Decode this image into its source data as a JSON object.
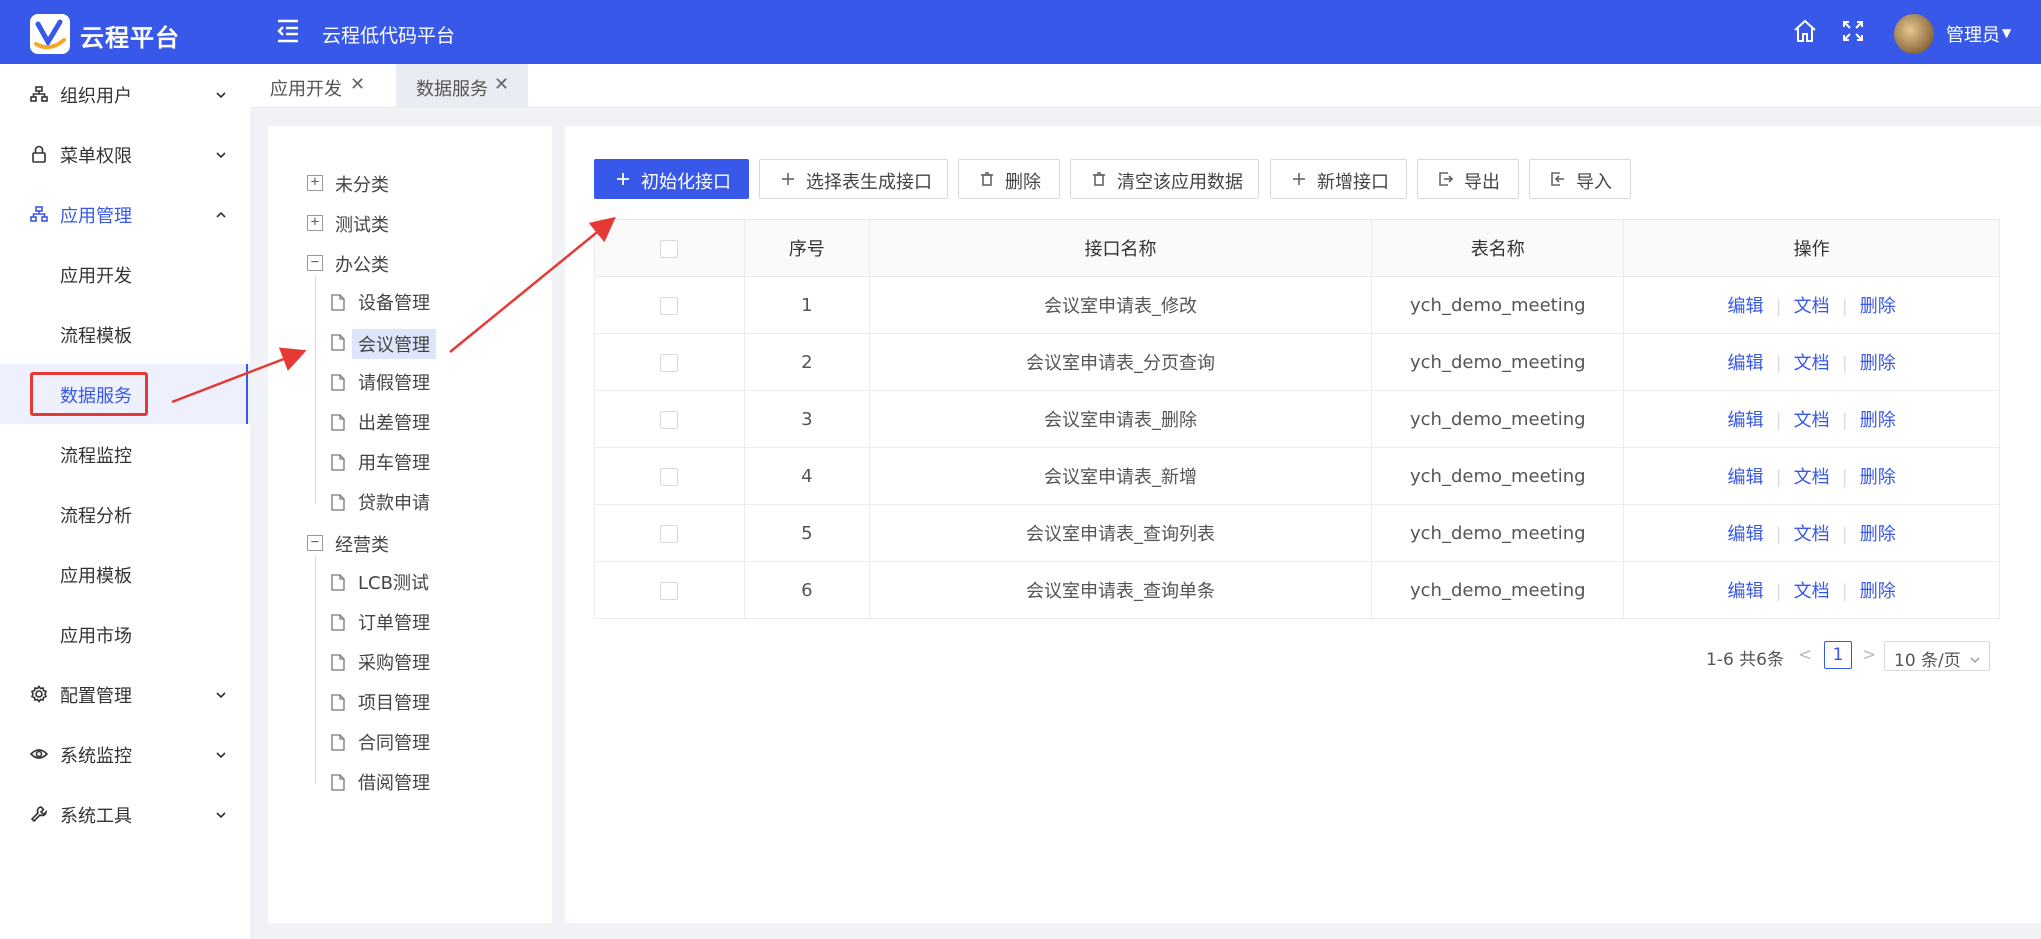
{
  "header": {
    "app_title": "云程平台",
    "platform_title": "云程低代码平台",
    "user_name": "管理员",
    "bg_color": "#3858e9"
  },
  "sidebar": {
    "items": [
      {
        "label": "组织用户",
        "icon": "org-icon",
        "expandable": true
      },
      {
        "label": "菜单权限",
        "icon": "lock-icon",
        "expandable": true
      },
      {
        "label": "应用管理",
        "icon": "app-tree-icon",
        "expandable": true,
        "expanded": true
      },
      {
        "label": "应用开发"
      },
      {
        "label": "流程模板"
      },
      {
        "label": "数据服务",
        "selected": true
      },
      {
        "label": "流程监控"
      },
      {
        "label": "流程分析"
      },
      {
        "label": "应用模板"
      },
      {
        "label": "应用市场"
      },
      {
        "label": "配置管理",
        "icon": "gear-icon",
        "expandable": true
      },
      {
        "label": "系统监控",
        "icon": "eye-icon",
        "expandable": true
      },
      {
        "label": "系统工具",
        "icon": "wrench-icon",
        "expandable": true
      }
    ]
  },
  "tabs": [
    {
      "label": "应用开发",
      "active": false
    },
    {
      "label": "数据服务",
      "active": true
    }
  ],
  "tree": {
    "categories": [
      {
        "label": "未分类",
        "expanded": false,
        "children": []
      },
      {
        "label": "测试类",
        "expanded": false,
        "children": []
      },
      {
        "label": "办公类",
        "expanded": true,
        "children": [
          "设备管理",
          "会议管理",
          "请假管理",
          "出差管理",
          "用车管理",
          "贷款申请"
        ]
      },
      {
        "label": "经营类",
        "expanded": true,
        "children": [
          "LCB测试",
          "订单管理",
          "采购管理",
          "项目管理",
          "合同管理",
          "借阅管理"
        ]
      }
    ],
    "selected": "会议管理"
  },
  "toolbar": {
    "buttons": [
      {
        "label": "初始化接口",
        "icon": "plus-icon",
        "primary": true
      },
      {
        "label": "选择表生成接口",
        "icon": "plus-icon"
      },
      {
        "label": "删除",
        "icon": "trash-icon"
      },
      {
        "label": "清空该应用数据",
        "icon": "trash-icon"
      },
      {
        "label": "新增接口",
        "icon": "plus-icon"
      },
      {
        "label": "导出",
        "icon": "export-icon"
      },
      {
        "label": "导入",
        "icon": "import-icon"
      }
    ]
  },
  "table": {
    "headers": [
      "",
      "序号",
      "接口名称",
      "表名称",
      "操作"
    ],
    "rows": [
      {
        "index": "1",
        "name": "会议室申请表_修改",
        "table": "ych_demo_meeting"
      },
      {
        "index": "2",
        "name": "会议室申请表_分页查询",
        "table": "ych_demo_meeting"
      },
      {
        "index": "3",
        "name": "会议室申请表_删除",
        "table": "ych_demo_meeting"
      },
      {
        "index": "4",
        "name": "会议室申请表_新增",
        "table": "ych_demo_meeting"
      },
      {
        "index": "5",
        "name": "会议室申请表_查询列表",
        "table": "ych_demo_meeting"
      },
      {
        "index": "6",
        "name": "会议室申请表_查询单条",
        "table": "ych_demo_meeting"
      }
    ],
    "ops": [
      "编辑",
      "文档",
      "删除"
    ]
  },
  "pagination": {
    "total_text": "1-6 共6条",
    "current_page": "1",
    "page_size": "10 条/页"
  }
}
